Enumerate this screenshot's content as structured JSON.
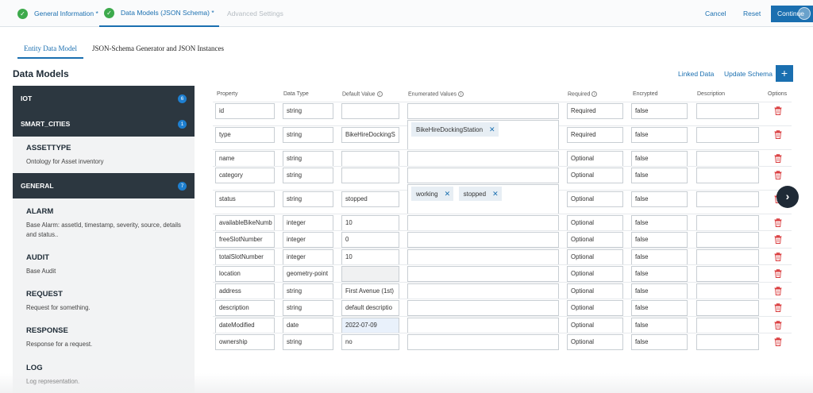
{
  "steps": [
    {
      "label": "General Information *",
      "state": "done"
    },
    {
      "label": "Data Models (JSON Schema) *",
      "state": "active"
    },
    {
      "label": "Advanced Settings",
      "state": "disabled"
    }
  ],
  "top_actions": {
    "cancel": "Cancel",
    "reset": "Reset",
    "continue": "Continue"
  },
  "subtabs": [
    "Entity Data Model",
    "JSON-Schema Generator and JSON Instances"
  ],
  "section_title": "Data Models",
  "actions": {
    "linked_data": "Linked Data",
    "update_schema": "Update Schema",
    "add": "+"
  },
  "sidebar": {
    "groups": [
      {
        "label": "IOT",
        "count": "6"
      },
      {
        "label": "SMART_CITIES",
        "count": "1"
      },
      {
        "label": "GENERAL",
        "count": "7"
      }
    ],
    "items": [
      {
        "name": "ASSETTYPE",
        "desc": "Ontology for Asset inventory"
      },
      {
        "name": "ALARM",
        "desc": "Base Alarm: assetId, timestamp, severity, source, details and status.."
      },
      {
        "name": "AUDIT",
        "desc": "Base Audit"
      },
      {
        "name": "REQUEST",
        "desc": "Request for something."
      },
      {
        "name": "RESPONSE",
        "desc": "Response for a request."
      },
      {
        "name": "LOG",
        "desc": "Log representation."
      }
    ]
  },
  "table": {
    "headers": [
      "Property",
      "Data Type",
      "Default Value",
      "Enumerated Values",
      "Required",
      "Encrypted",
      "Description",
      "Options"
    ],
    "rows": [
      {
        "property": "id",
        "type": "string",
        "default": "",
        "required": "Required",
        "encrypted": "false",
        "enum": []
      },
      {
        "property": "type",
        "type": "string",
        "default": "BikeHireDockingS",
        "required": "Required",
        "encrypted": "false",
        "enum": [
          "BikeHireDockingStation"
        ]
      },
      {
        "property": "name",
        "type": "string",
        "default": "",
        "required": "Optional",
        "encrypted": "false",
        "enum": []
      },
      {
        "property": "category",
        "type": "string",
        "default": "",
        "required": "Optional",
        "encrypted": "false",
        "enum": []
      },
      {
        "property": "status",
        "type": "string",
        "default": "stopped",
        "required": "Optional",
        "encrypted": "false",
        "enum": [
          "working",
          "stopped"
        ]
      },
      {
        "property": "availableBikeNumb",
        "type": "integer",
        "default": "10",
        "required": "Optional",
        "encrypted": "false",
        "enum": []
      },
      {
        "property": "freeSlotNumber",
        "type": "integer",
        "default": "0",
        "required": "Optional",
        "encrypted": "false",
        "enum": []
      },
      {
        "property": "totalSlotNumber",
        "type": "integer",
        "default": "10",
        "required": "Optional",
        "encrypted": "false",
        "enum": []
      },
      {
        "property": "location",
        "type": "geometry-point",
        "default": "",
        "required": "Optional",
        "encrypted": "false",
        "enum": []
      },
      {
        "property": "address",
        "type": "string",
        "default": "First Avenue (1st)",
        "required": "Optional",
        "encrypted": "false",
        "enum": []
      },
      {
        "property": "description",
        "type": "string",
        "default": "default descriptio",
        "required": "Optional",
        "encrypted": "false",
        "enum": []
      },
      {
        "property": "dateModified",
        "type": "date",
        "default": "2022-07-09",
        "required": "Optional",
        "encrypted": "false",
        "enum": []
      },
      {
        "property": "ownership",
        "type": "string",
        "default": "no",
        "required": "Optional",
        "encrypted": "false",
        "enum": []
      }
    ]
  },
  "icons": {
    "check": "check-icon",
    "trash": "trash-icon",
    "info": "info-icon",
    "chevron": "chevron-right-icon",
    "chip_remove": "close-icon"
  },
  "colors": {
    "accent": "#1a6fb0",
    "success": "#3daa4c",
    "danger": "#d9383a",
    "sidebar_header": "#2c3740"
  }
}
